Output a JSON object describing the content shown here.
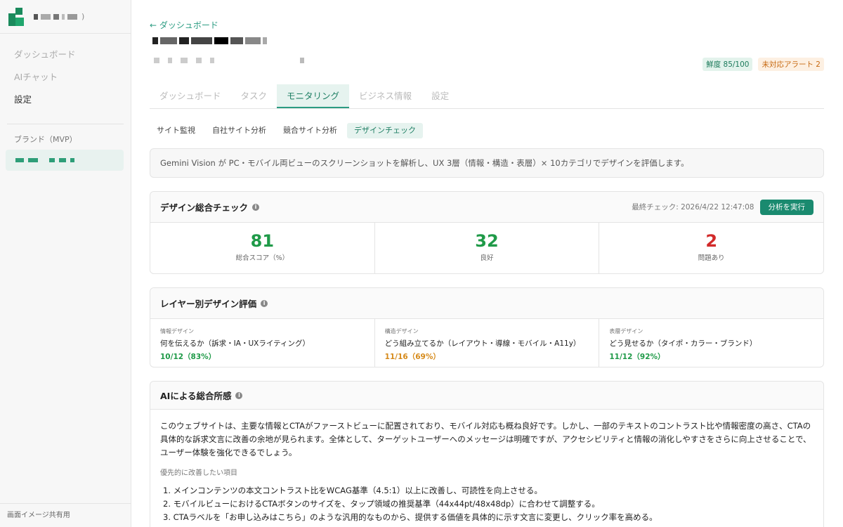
{
  "sidebar": {
    "brand_paren": ")",
    "nav": [
      {
        "label": "ダッシュボード"
      },
      {
        "label": "AIチャット"
      },
      {
        "label": "設定"
      }
    ],
    "section_label": "ブランド（MVP）",
    "footer": "画面イメージ共有用"
  },
  "header": {
    "back_link": "← ダッシュボード",
    "freshness_badge": "鮮度 85/100",
    "alert_badge": "未対応アラート 2"
  },
  "tabs": [
    {
      "label": "ダッシュボード",
      "active": false
    },
    {
      "label": "タスク",
      "active": false
    },
    {
      "label": "モニタリング",
      "active": true
    },
    {
      "label": "ビジネス情報",
      "active": false
    },
    {
      "label": "設定",
      "active": false
    }
  ],
  "subtabs": [
    {
      "label": "サイト監視",
      "active": false
    },
    {
      "label": "自社サイト分析",
      "active": false
    },
    {
      "label": "競合サイト分析",
      "active": false
    },
    {
      "label": "デザインチェック",
      "active": true
    }
  ],
  "info_text": "Gemini Vision が PC・モバイル両ビューのスクリーンショットを解析し、UX 3層（情報・構造・表層）× 10カテゴリでデザインを評価します。",
  "overall": {
    "title": "デザイン総合チェック",
    "last_check": "最終チェック: 2026/4/22 12:47:08",
    "run_button": "分析を実行",
    "stats": [
      {
        "value": "81",
        "label": "総合スコア（%）",
        "color": "#1f9a48"
      },
      {
        "value": "32",
        "label": "良好",
        "color": "#1f9a48"
      },
      {
        "value": "2",
        "label": "問題あり",
        "color": "#d22a2a"
      }
    ]
  },
  "layers": {
    "title": "レイヤー別デザイン評価",
    "items": [
      {
        "tag": "情報デザイン",
        "desc": "何を伝えるか（訴求・IA・UXライティング）",
        "score": "10/12（83%）",
        "color": "#1f9a48"
      },
      {
        "tag": "構造デザイン",
        "desc": "どう組み立てるか（レイアウト・導線・モバイル・A11y）",
        "score": "11/16（69%）",
        "color": "#d68a1a"
      },
      {
        "tag": "表層デザイン",
        "desc": "どう見せるか（タイポ・カラー・ブランド）",
        "score": "11/12（92%）",
        "color": "#1f9a48"
      }
    ]
  },
  "ai_summary": {
    "title": "AIによる総合所感",
    "body": "このウェブサイトは、主要な情報とCTAがファーストビューに配置されており、モバイル対応も概ね良好です。しかし、一部のテキストのコントラスト比や情報密度の高さ、CTAの具体的な訴求文言に改善の余地が見られます。全体として、ターゲットユーザーへのメッセージは明確ですが、アクセシビリティと情報の消化しやすさをさらに向上させることで、ユーザー体験を強化できるでしょう。",
    "priority_label": "優先的に改善したい項目",
    "priorities": [
      "1. メインコンテンツの本文コントラスト比をWCAG基準（4.5:1）以上に改善し、可読性を向上させる。",
      "2. モバイルビューにおけるCTAボタンのサイズを、タップ領域の推奨基準（44x44pt/48x48dp）に合わせて調整する。",
      "3. CTAラベルを「お申し込みはこちら」のような汎用的なものから、提供する価値を具体的に示す文言に変更し、クリック率を高める。"
    ]
  }
}
